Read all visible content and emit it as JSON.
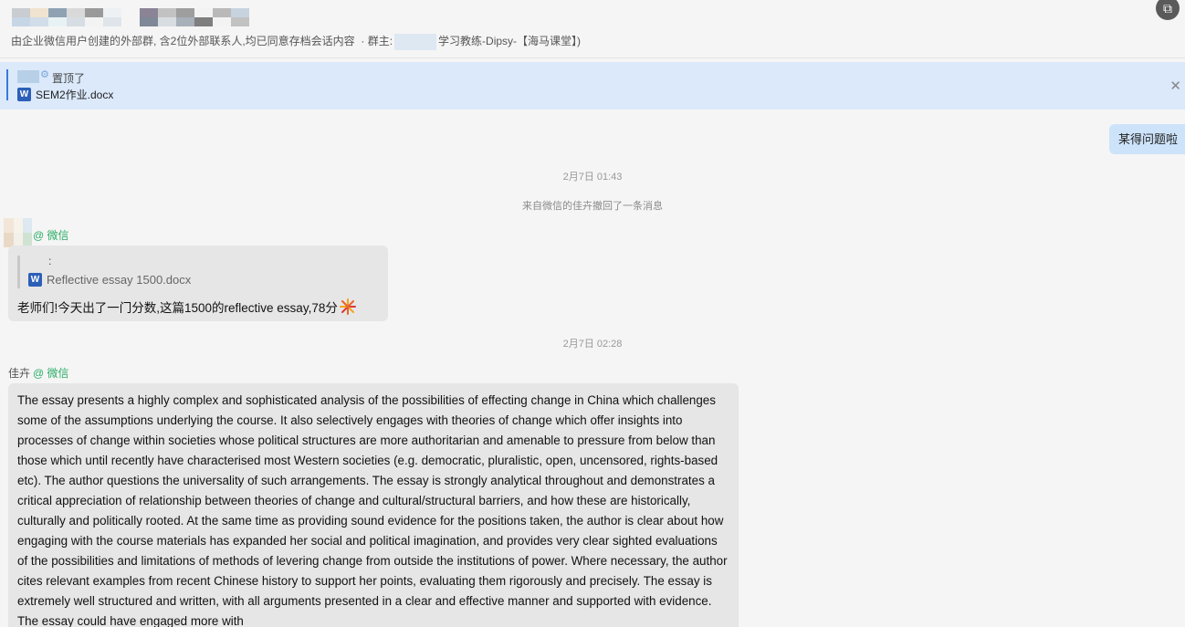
{
  "header": {
    "subtitle": "由企业微信用户创建的外部群, 含2位外部联系人,均已同意存档会话内容",
    "owner_label": "· 群主:",
    "owner_suffix": "学习教练-Dipsy-【海马课堂】)",
    "corner_icon": "screenshot-icon"
  },
  "pinned": {
    "label": "置顶了",
    "file_name": "SEM2作业.docx",
    "file_icon_letter": "W"
  },
  "messages": {
    "self_bubble": "某得问题啦",
    "time1": "2月7日 01:43",
    "recall_notice": "来自微信的佳卉撤回了一条消息",
    "msg1": {
      "source_tag": "@ 微信",
      "quote_colon": ":",
      "quote_file": "Reflective essay 1500.docx",
      "text": "老师们!今天出了一门分数,这篇1500的reflective essay,78分"
    },
    "time2": "2月7日 02:28",
    "msg2": {
      "sender": "佳卉",
      "source_tag": "@ 微信",
      "text": "The essay presents a highly complex and sophisticated analysis of the possibilities of effecting change in China which challenges some of the assumptions underlying the course. It also selectively engages with theories of change which offer insights into processes of change within societies whose political structures are more authoritarian and amenable to pressure from below than those which until recently have characterised most Western societies (e.g. democratic, pluralistic, open, uncensored, rights-based etc). The author questions the universality of such arrangements. The essay is strongly analytical throughout and demonstrates a critical appreciation of relationship between theories of change and cultural/structural barriers, and how these are historically, culturally and politically rooted. At the same time as providing sound evidence for the positions taken, the author is clear about how engaging with the course materials has expanded her social and political imagination, and provides very clear sighted evaluations of the possibilities and limitations of methods of levering change from outside the institutions of power. Where necessary, the author cites relevant examples from recent Chinese history to support her points, evaluating them rigorously and precisely. The essay is extremely well structured and written, with all arguments presented in a clear and effective manner and supported with evidence. The essay could have engaged more with"
    }
  },
  "colors": {
    "accent": "#3a79d8",
    "wechat_green": "#2aae67",
    "self_bubble_bg": "#cde3fa",
    "pinned_bg": "#dbe9fb"
  }
}
